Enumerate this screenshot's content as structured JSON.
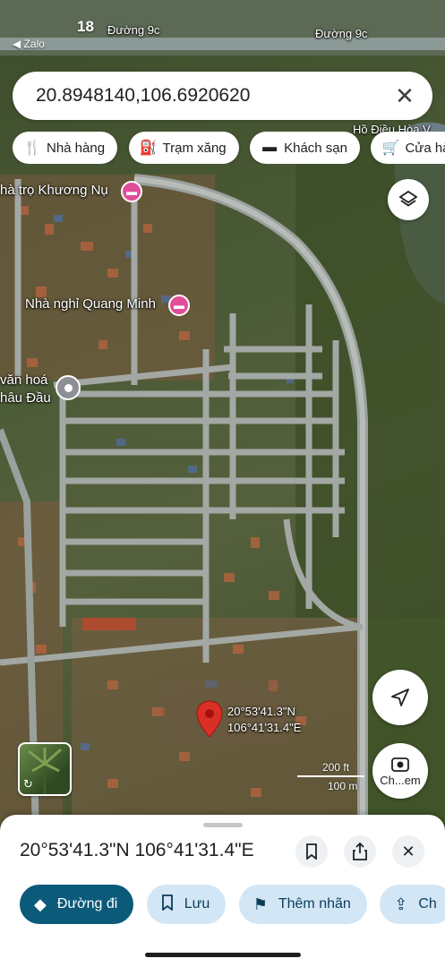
{
  "status_bar": {
    "time": "18",
    "back_app": "◀ Zalo"
  },
  "map": {
    "street_labels": [
      "Đường 9c",
      "Đường 9c"
    ],
    "place_labels": {
      "lake": "Hồ Điều Hòa V",
      "guesthouse_1": "hà trọ Khương Nụ",
      "guesthouse_2": "Nhà nghỉ Quang Minh",
      "culture_house_line1": "văn hoá",
      "culture_house_line2": "hâu Đầu"
    },
    "pin_coordinates": {
      "lat": "20°53'41.3\"N",
      "lng": "106°41'31.4\"E"
    },
    "scale": {
      "feet": "200 ft",
      "meters": "100 m"
    }
  },
  "search": {
    "value": "20.8948140,106.6920620",
    "clear_icon": "close-icon"
  },
  "chips": [
    {
      "label": "Nhà hàng",
      "icon": "restaurant-icon"
    },
    {
      "label": "Trạm xăng",
      "icon": "gas-station-icon"
    },
    {
      "label": "Khách sạn",
      "icon": "hotel-icon"
    },
    {
      "label": "Cửa hà",
      "icon": "shopping-cart-icon"
    }
  ],
  "controls": {
    "layers_icon": "layers-icon",
    "location_icon": "navigation-arrow-icon",
    "lens_label": "Ch...em"
  },
  "sheet": {
    "title": "20°53'41.3\"N 106°41'31.4\"E",
    "actions": [
      {
        "label": "Đường đi",
        "icon": "directions-icon"
      },
      {
        "label": "Lưu",
        "icon": "bookmark-icon"
      },
      {
        "label": "Thêm nhãn",
        "icon": "flag-icon"
      },
      {
        "label": "Ch",
        "icon": "share-icon"
      }
    ]
  },
  "colors": {
    "primary_action": "#0b5a79",
    "secondary_action": "#d3e6f5",
    "poi_pink": "#e24d99",
    "marker_red": "#d93025"
  }
}
